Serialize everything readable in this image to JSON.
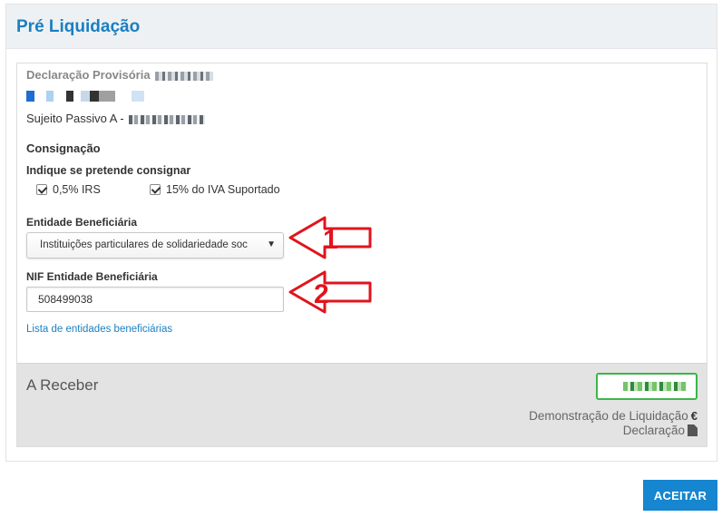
{
  "header": {
    "title": "Pré Liquidação"
  },
  "declaration": {
    "label": "Declaração Provisória"
  },
  "sujeito": {
    "label": "Sujeito Passivo A -"
  },
  "consignacao": {
    "title": "Consignação",
    "question": "Indique se pretende consignar",
    "option_irs": "0,5% IRS",
    "option_iva": "15% do IVA Suportado"
  },
  "entidade": {
    "label": "Entidade Beneficiária",
    "selected": "Instituições particulares de solidariedade soc"
  },
  "nif": {
    "label": "NIF Entidade Beneficiária",
    "value": "508499038"
  },
  "links": {
    "lista": "Lista de entidades beneficiárias"
  },
  "footer": {
    "receber": "A Receber",
    "demonstracao": "Demonstração de Liquidação",
    "declaracao": "Declaração",
    "euro_symbol": "€"
  },
  "actions": {
    "accept": "ACEITAR"
  },
  "annotations": {
    "callout_1": "1",
    "callout_2": "2"
  },
  "colors": {
    "accent": "#1a7fc1",
    "button": "#1586cf",
    "callout": "#e0141e",
    "amount_border": "#3cb54a"
  },
  "icons": {
    "dropdown": "chevron-down-icon",
    "euro": "euro-icon",
    "document": "document-icon",
    "checkbox": "checkbox-checked-icon"
  }
}
